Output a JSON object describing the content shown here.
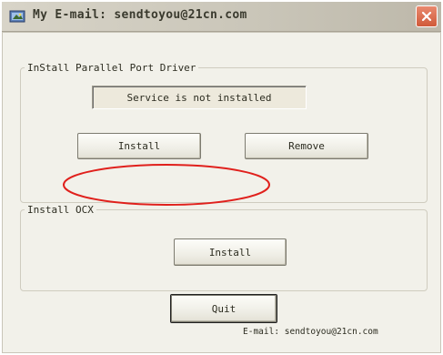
{
  "window": {
    "title": "My E-mail: sendtoyou@21cn.com",
    "app_icon": "app-window-icon",
    "close_icon": "close-icon"
  },
  "driver_group": {
    "legend": "InStall Parallel Port Driver",
    "status_text": "Service is not installed",
    "install_label": "Install",
    "remove_label": "Remove"
  },
  "ocx_group": {
    "legend": "Install OCX",
    "install_label": "Install"
  },
  "quit_label": "Quit",
  "footer": {
    "email_text": "E-mail: sendtoyou@21cn.com"
  },
  "colors": {
    "annotation": "#e0201c",
    "close_button": "#d05a3a"
  }
}
